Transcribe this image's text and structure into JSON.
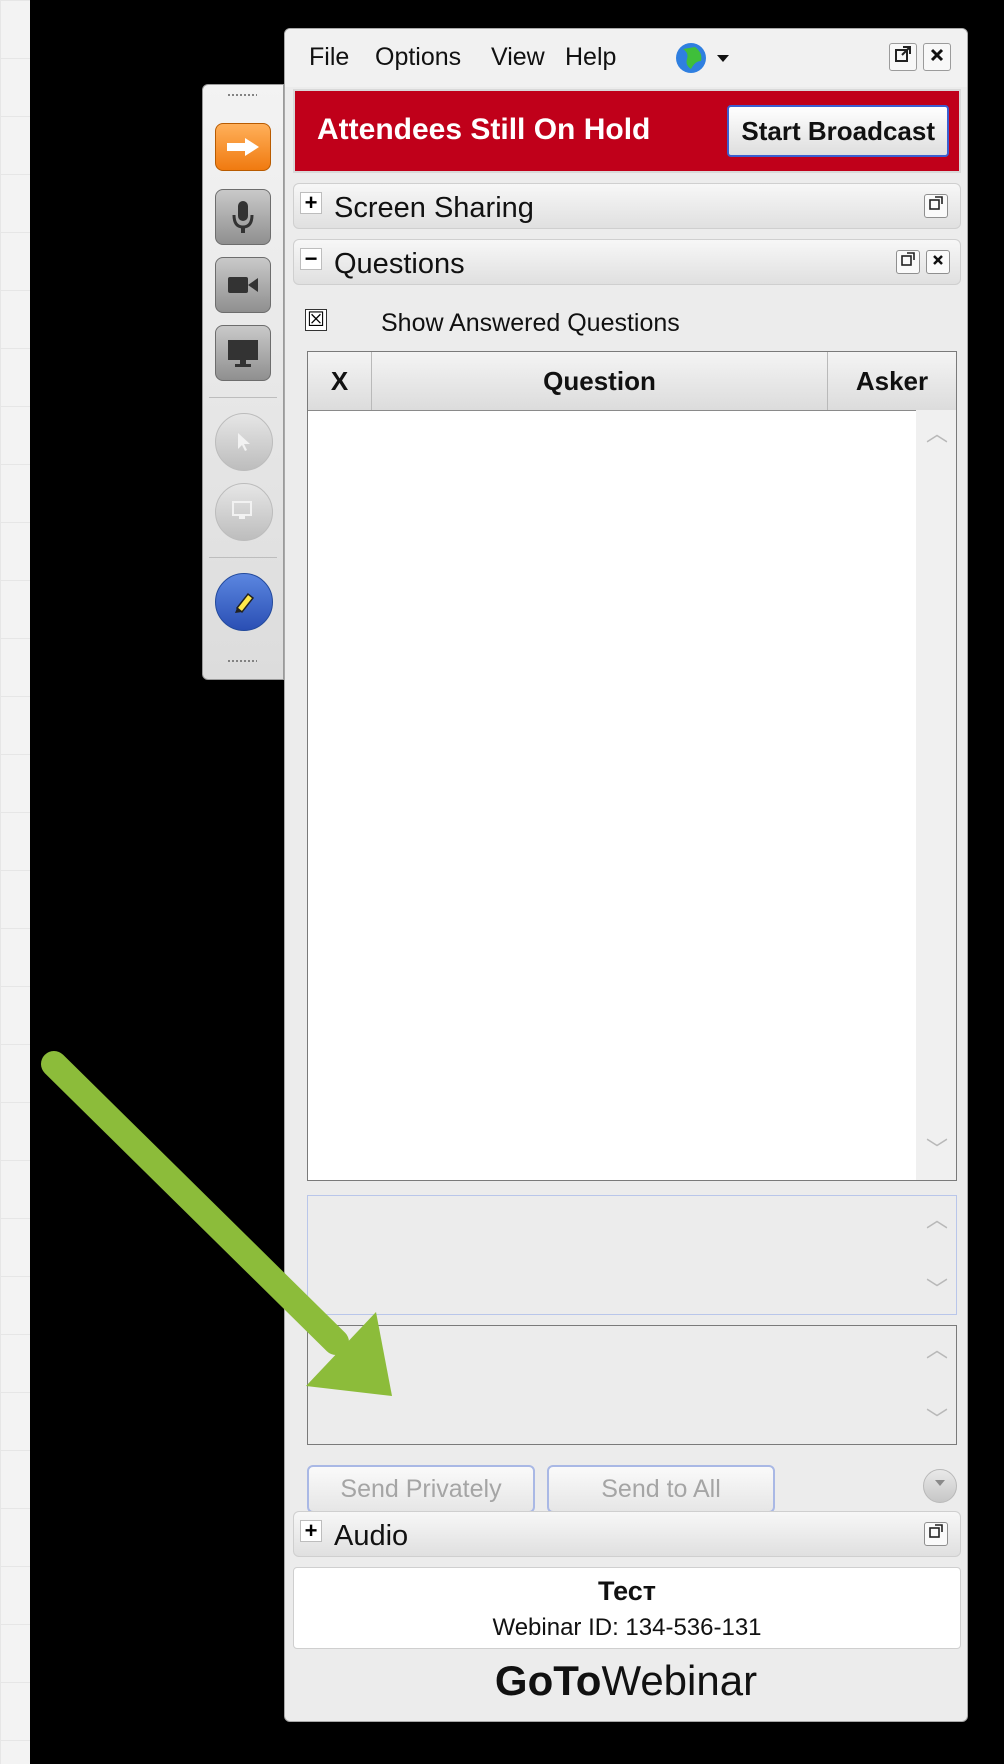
{
  "menu": {
    "items": [
      "File",
      "Options",
      "View",
      "Help"
    ],
    "globe_icon": "globe-icon"
  },
  "window_controls": {
    "popout": "↗",
    "close": "✕"
  },
  "status_bar": {
    "message": "Attendees Still On Hold",
    "button": "Start Broadcast",
    "color": "#c0001a"
  },
  "sections": {
    "screen_sharing": {
      "sign": "+",
      "title": "Screen Sharing"
    },
    "questions": {
      "sign": "−",
      "title": "Questions"
    },
    "audio": {
      "sign": "+",
      "title": "Audio"
    }
  },
  "questions": {
    "show_answered_label": "Show Answered Questions",
    "show_answered_checked": true,
    "checkbox_mark": "☒",
    "columns": [
      "X",
      "Question",
      "Asker"
    ],
    "rows": []
  },
  "actions": {
    "send_privately": "Send Privately",
    "send_to_all": "Send to All"
  },
  "footer": {
    "title": "Тест",
    "webinar_id": "Webinar ID: 134-536-131",
    "brand_bold": "GoTo",
    "brand_light": "Webinar"
  },
  "annotation": {
    "arrow_color": "#8cbc3a"
  }
}
